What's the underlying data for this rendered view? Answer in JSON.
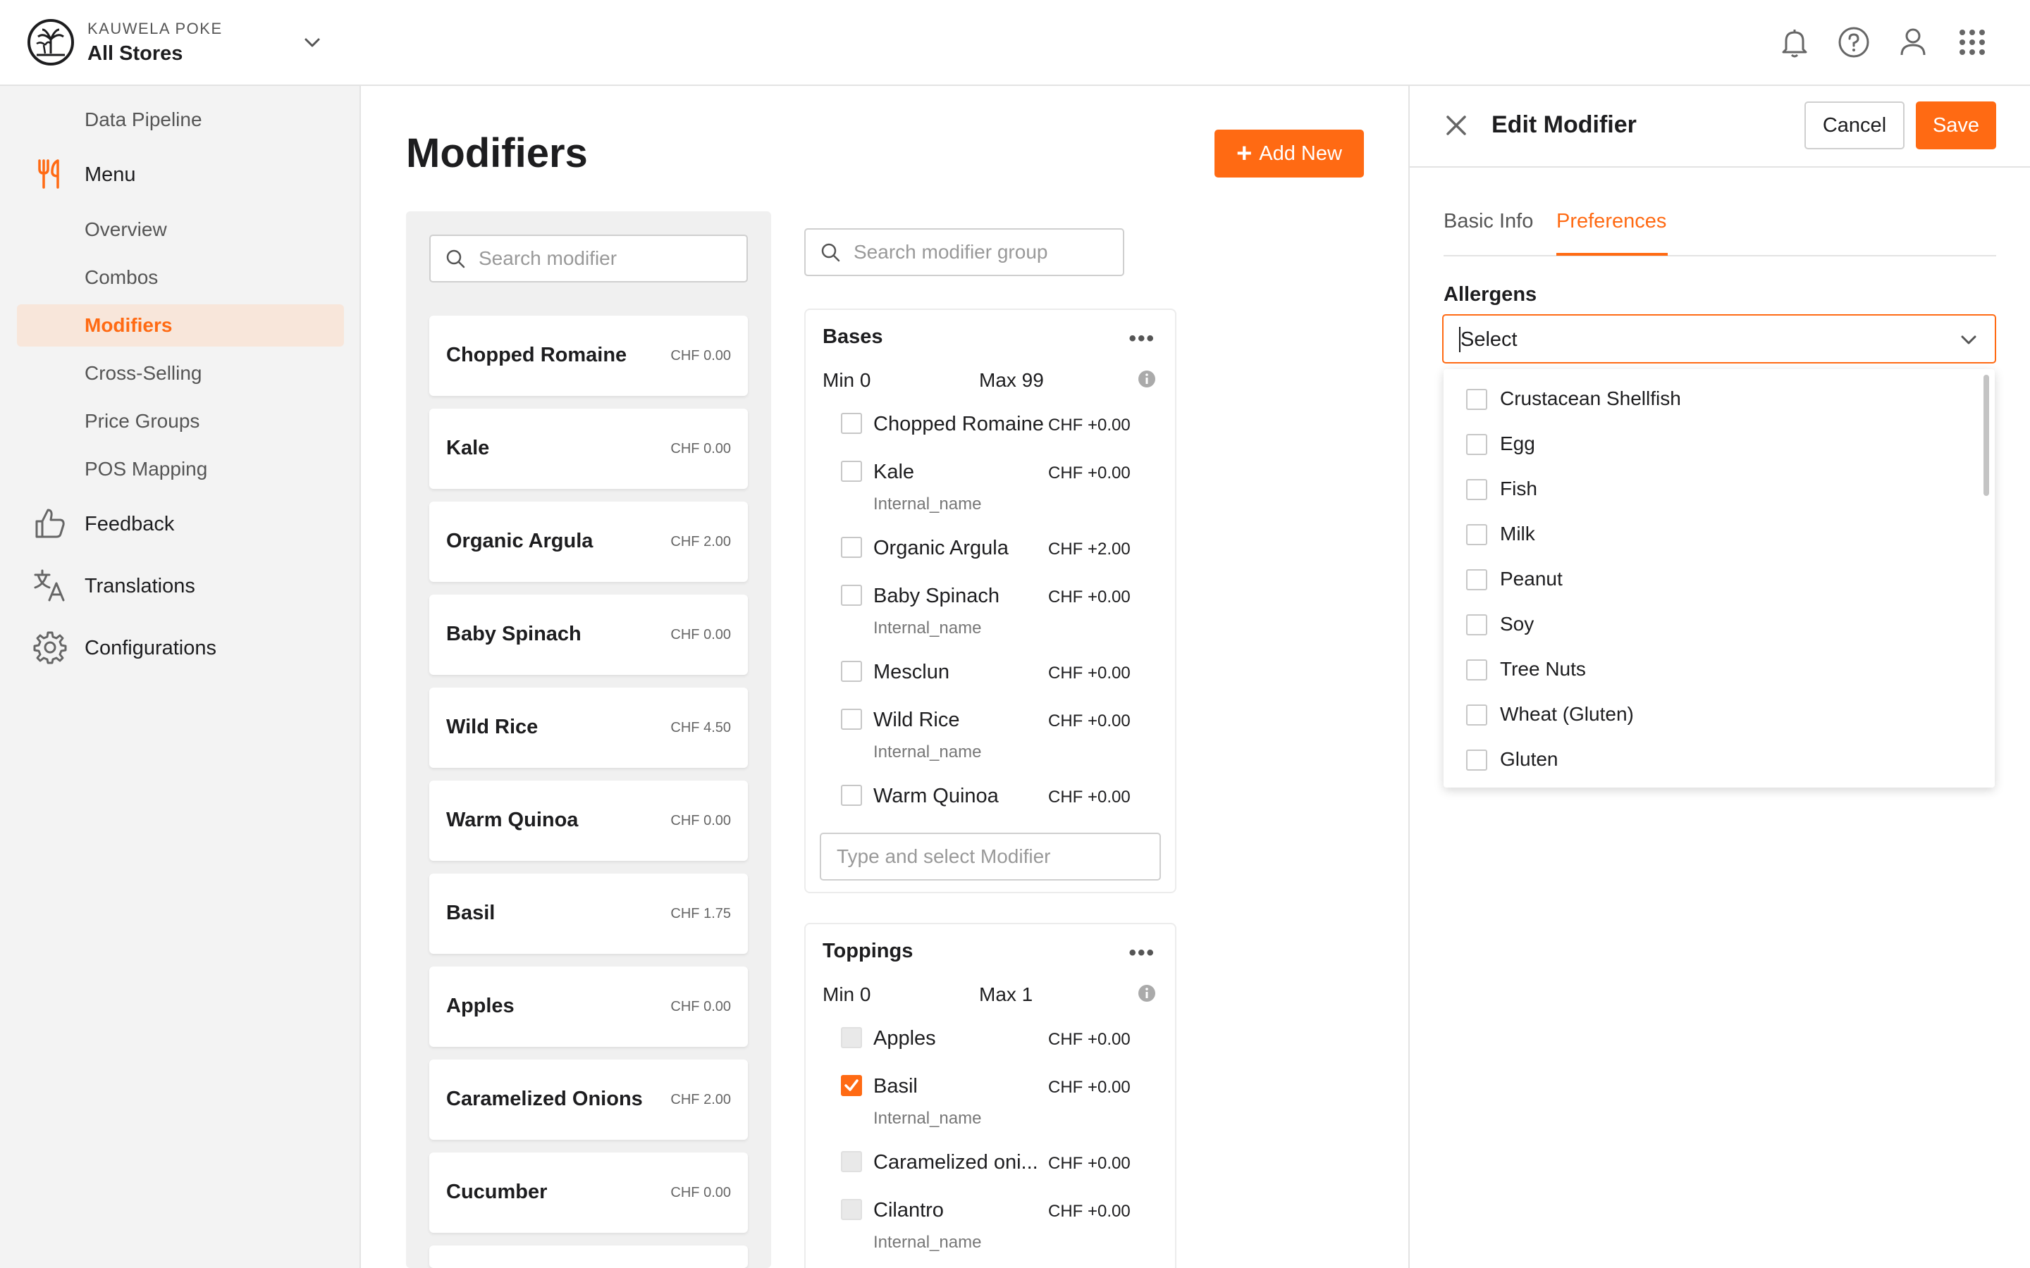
{
  "header": {
    "brand": "KAUWELA POKE",
    "store": "All Stores"
  },
  "sidebar": {
    "data_pipeline": "Data Pipeline",
    "menu": "Menu",
    "menu_items": [
      "Overview",
      "Combos",
      "Modifiers",
      "Cross-Selling",
      "Price Groups",
      "POS Mapping"
    ],
    "active_item": "Modifiers",
    "feedback": "Feedback",
    "translations": "Translations",
    "configurations": "Configurations"
  },
  "main": {
    "title": "Modifiers",
    "add_new_label": "Add New",
    "search_modifier_placeholder": "Search modifier",
    "search_group_placeholder": "Search modifier group",
    "modifiers": [
      {
        "name": "Chopped Romaine",
        "price": "CHF 0.00"
      },
      {
        "name": "Kale",
        "price": "CHF 0.00"
      },
      {
        "name": "Organic Argula",
        "price": "CHF 2.00"
      },
      {
        "name": "Baby Spinach",
        "price": "CHF 0.00"
      },
      {
        "name": "Wild Rice",
        "price": "CHF 4.50"
      },
      {
        "name": "Warm Quinoa",
        "price": "CHF 0.00"
      },
      {
        "name": "Basil",
        "price": "CHF 1.75"
      },
      {
        "name": "Apples",
        "price": "CHF 0.00"
      },
      {
        "name": "Caramelized Onions",
        "price": "CHF 2.00"
      },
      {
        "name": "Cucumber",
        "price": "CHF 0.00"
      }
    ],
    "groups": [
      {
        "title": "Bases",
        "more": "•••",
        "min": "Min 0",
        "max": "Max 99",
        "options": [
          {
            "name": "Chopped Romaine",
            "price": "CHF +0.00",
            "sub": ""
          },
          {
            "name": "Kale",
            "price": "CHF +0.00",
            "sub": "Internal_name"
          },
          {
            "name": "Organic Argula",
            "price": "CHF +2.00",
            "sub": ""
          },
          {
            "name": "Baby Spinach",
            "price": "CHF +0.00",
            "sub": "Internal_name"
          },
          {
            "name": "Mesclun",
            "price": "CHF +0.00",
            "sub": ""
          },
          {
            "name": "Wild Rice",
            "price": "CHF +0.00",
            "sub": "Internal_name"
          },
          {
            "name": "Warm Quinoa",
            "price": "CHF +0.00",
            "sub": ""
          }
        ],
        "type_select_placeholder": "Type and select Modifier"
      },
      {
        "title": "Toppings",
        "more": "•••",
        "min": "Min 0",
        "max": "Max 1",
        "options": [
          {
            "name": "Apples",
            "price": "CHF +0.00",
            "sub": "",
            "state": "disabled"
          },
          {
            "name": "Basil",
            "price": "CHF +0.00",
            "sub": "Internal_name",
            "state": "checked"
          },
          {
            "name": "Caramelized oni...",
            "price": "CHF +0.00",
            "sub": "",
            "state": "disabled"
          },
          {
            "name": "Cilantro",
            "price": "CHF +0.00",
            "sub": "Internal_name",
            "state": "disabled"
          }
        ]
      }
    ]
  },
  "drawer": {
    "title": "Edit Modifier",
    "cancel_label": "Cancel",
    "save_label": "Save",
    "tabs": [
      "Basic Info",
      "Preferences"
    ],
    "active_tab": "Preferences",
    "allergens_label": "Allergens",
    "select_value": "Select",
    "allergen_options": [
      "Crustacean Shellfish",
      "Egg",
      "Fish",
      "Milk",
      "Peanut",
      "Soy",
      "Tree Nuts",
      "Wheat (Gluten)",
      "Gluten"
    ]
  },
  "colors": {
    "accent": "#ff6a13",
    "active_bg": "#f8e6da",
    "sidebar_bg": "#f3f3f3"
  },
  "icons": {
    "logo": "palm-tree-logo-icon",
    "top": [
      "bell-icon",
      "help-icon",
      "user-icon",
      "apps-grid-icon"
    ],
    "sidebar": [
      "fork-knife-icon",
      "thumbs-up-icon",
      "translate-icon",
      "gear-icon"
    ]
  }
}
